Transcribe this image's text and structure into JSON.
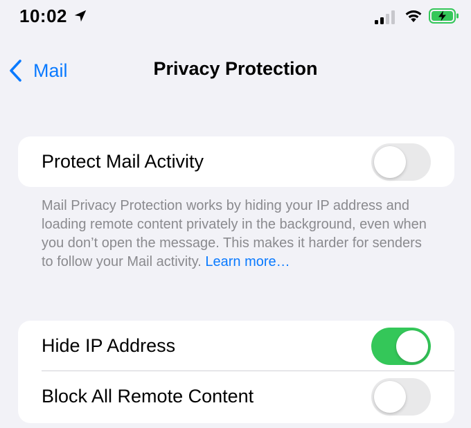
{
  "status_bar": {
    "time": "10:02",
    "icons": [
      "location-arrow-icon",
      "cellular-signal-icon",
      "wifi-icon",
      "battery-charging-icon"
    ],
    "battery_color": "#34c759"
  },
  "nav": {
    "back_label": "Mail",
    "title": "Privacy Protection"
  },
  "groups": [
    {
      "rows": [
        {
          "label": "Protect Mail Activity",
          "toggle_on": false
        }
      ]
    },
    {
      "rows": [
        {
          "label": "Hide IP Address",
          "toggle_on": true
        },
        {
          "label": "Block All Remote Content",
          "toggle_on": false
        }
      ]
    }
  ],
  "footer": {
    "text": "Mail Privacy Protection works by hiding your IP address and loading remote content privately in the background, even when you don’t open the message. This makes it harder for senders to follow your Mail activity.",
    "link": "Learn more…"
  },
  "colors": {
    "accent": "#0a7aff",
    "toggle_on": "#34c759",
    "toggle_off": "#e9e9ea",
    "background": "#f2f2f7"
  }
}
